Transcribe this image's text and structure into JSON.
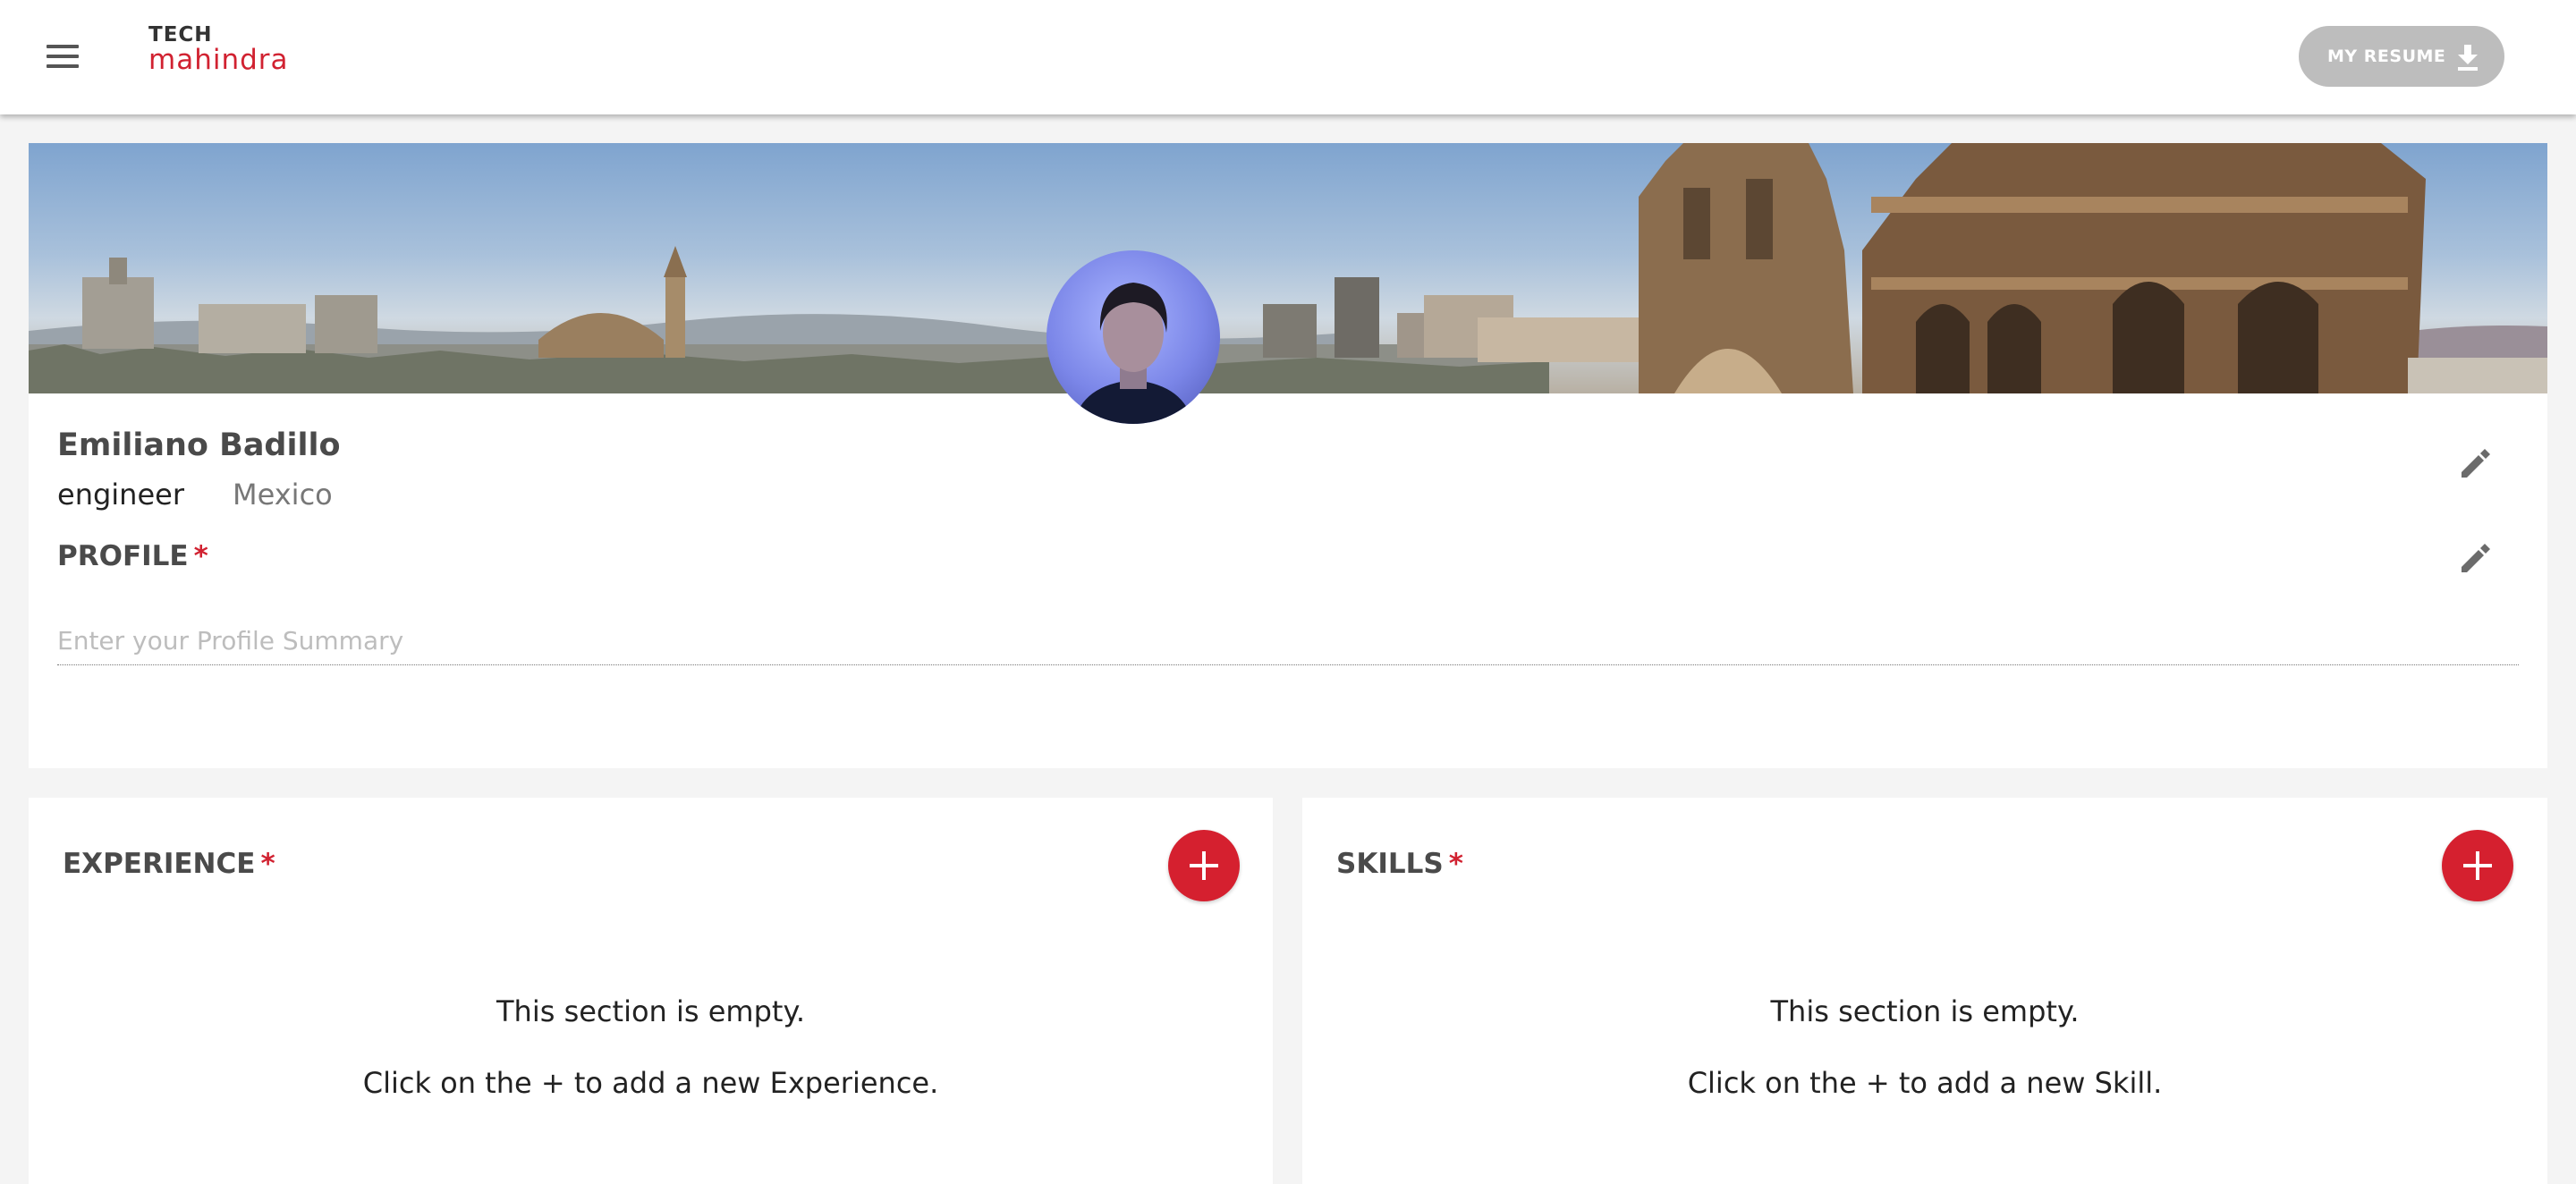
{
  "header": {
    "logo_top": "TECH",
    "logo_bottom": "mahindra",
    "resume_button_label": "MY RESUME"
  },
  "profile": {
    "name": "Emiliano Badillo",
    "role": "engineer",
    "location": "Mexico",
    "section_title": "PROFILE",
    "required_mark": "*",
    "summary_placeholder": "Enter your Profile Summary",
    "summary_value": ""
  },
  "experience": {
    "title": "EXPERIENCE",
    "required_mark": "*",
    "empty_line1": "This section is empty.",
    "empty_line2": "Click on the + to add a new Experience."
  },
  "skills": {
    "title": "SKILLS",
    "required_mark": "*",
    "empty_line1": "This section is empty.",
    "empty_line2": "Click on the + to add a new Skill."
  },
  "colors": {
    "brand_red": "#d12231",
    "add_button": "#d5202f",
    "resume_button_bg": "#bdbdbd",
    "page_bg": "#f4f4f4"
  },
  "icons": [
    "menu-icon",
    "download-icon",
    "edit-icon",
    "plus-icon"
  ]
}
